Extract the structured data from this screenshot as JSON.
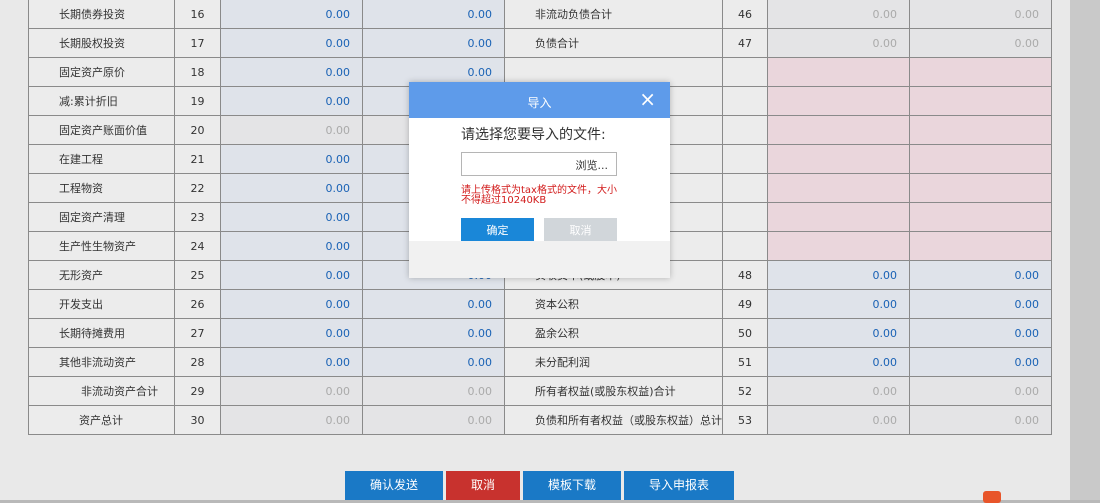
{
  "left_rows": [
    {
      "name": "长期债券投资",
      "no": "16",
      "c1": "0.00",
      "c2": "0.00",
      "ro": false
    },
    {
      "name": "长期股权投资",
      "no": "17",
      "c1": "0.00",
      "c2": "0.00",
      "ro": false
    },
    {
      "name": "固定资产原价",
      "no": "18",
      "c1": "0.00",
      "c2": "0.00",
      "ro": false
    },
    {
      "name": "减:累计折旧",
      "no": "19",
      "c1": "0.00",
      "c2": "0.00",
      "ro": false
    },
    {
      "name": "固定资产账面价值",
      "no": "20",
      "c1": "0.00",
      "c2": "0.00",
      "ro": true
    },
    {
      "name": "在建工程",
      "no": "21",
      "c1": "0.00",
      "c2": "0.00",
      "ro": false
    },
    {
      "name": "工程物资",
      "no": "22",
      "c1": "0.00",
      "c2": "0.00",
      "ro": false
    },
    {
      "name": "固定资产清理",
      "no": "23",
      "c1": "0.00",
      "c2": "0.00",
      "ro": false
    },
    {
      "name": "生产性生物资产",
      "no": "24",
      "c1": "0.00",
      "c2": "0.00",
      "ro": false
    },
    {
      "name": "无形资产",
      "no": "25",
      "c1": "0.00",
      "c2": "0.00",
      "ro": false
    },
    {
      "name": "开发支出",
      "no": "26",
      "c1": "0.00",
      "c2": "0.00",
      "ro": false
    },
    {
      "name": "长期待摊费用",
      "no": "27",
      "c1": "0.00",
      "c2": "0.00",
      "ro": false
    },
    {
      "name": "其他非流动资产",
      "no": "28",
      "c1": "0.00",
      "c2": "0.00",
      "ro": false
    },
    {
      "name": "非流动资产合计",
      "no": "29",
      "c1": "0.00",
      "c2": "0.00",
      "ro": true
    },
    {
      "name": "资产总计",
      "no": "30",
      "c1": "0.00",
      "c2": "0.00",
      "ro": true
    }
  ],
  "right_rows": [
    {
      "name": "非流动负债合计",
      "no": "46",
      "c1": "0.00",
      "c2": "0.00",
      "ro": true
    },
    {
      "name": "负债合计",
      "no": "47",
      "c1": "0.00",
      "c2": "0.00",
      "ro": true
    },
    {
      "name": "",
      "no": "",
      "c1": "",
      "c2": "",
      "ro": false
    },
    {
      "name": "",
      "no": "",
      "c1": "",
      "c2": "",
      "ro": false
    },
    {
      "name": "",
      "no": "",
      "c1": "",
      "c2": "",
      "ro": false
    },
    {
      "name": "",
      "no": "",
      "c1": "",
      "c2": "",
      "ro": false
    },
    {
      "name": "",
      "no": "",
      "c1": "",
      "c2": "",
      "ro": false
    },
    {
      "name": "",
      "no": "",
      "c1": "",
      "c2": "",
      "ro": false
    },
    {
      "name": "",
      "no": "",
      "c1": "",
      "c2": "",
      "ro": false
    },
    {
      "name": "实收资本(或股本)",
      "no": "48",
      "c1": "0.00",
      "c2": "0.00",
      "ro": false
    },
    {
      "name": "资本公积",
      "no": "49",
      "c1": "0.00",
      "c2": "0.00",
      "ro": false
    },
    {
      "name": "盈余公积",
      "no": "50",
      "c1": "0.00",
      "c2": "0.00",
      "ro": false
    },
    {
      "name": "未分配利润",
      "no": "51",
      "c1": "0.00",
      "c2": "0.00",
      "ro": false
    },
    {
      "name": "所有者权益(或股东权益)合计",
      "no": "52",
      "c1": "0.00",
      "c2": "0.00",
      "ro": true
    },
    {
      "name": "负债和所有者权益（或股东权益）总计",
      "no": "53",
      "c1": "0.00",
      "c2": "0.00",
      "ro": true
    }
  ],
  "dialog": {
    "title": "导入",
    "close_icon": "×",
    "prompt": "请选择您要导入的文件:",
    "browse_label": "浏览...",
    "warning": "请上传格式为tax格式的文件，大小不得超过10240KB",
    "confirm": "确定",
    "cancel": "取消"
  },
  "buttons": {
    "send": "确认发送",
    "cancel": "取消",
    "template": "模板下载",
    "import": "导入申报表"
  },
  "colors": {
    "value_blue": "#1a62b5",
    "dialog_header": "#5e9bea",
    "primary": "#1a79c6",
    "danger": "#c8322e"
  }
}
